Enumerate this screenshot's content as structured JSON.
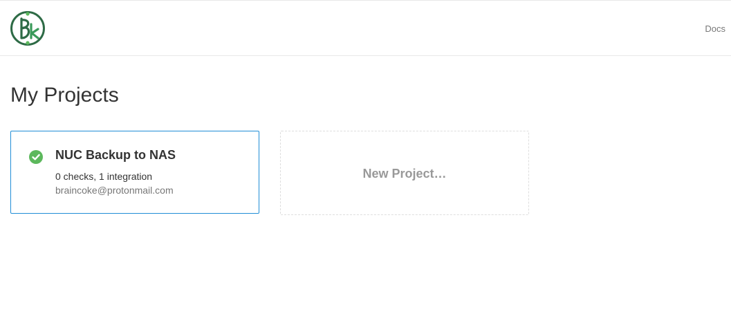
{
  "header": {
    "logo_name": "app-logo",
    "docs_label": "Docs"
  },
  "page": {
    "title": "My Projects"
  },
  "projects": [
    {
      "name": "NUC Backup to NAS",
      "summary": "0 checks, 1 integration",
      "owner": "braincoke@protonmail.com",
      "status_icon": "check-circle-icon",
      "status_color": "#5cb85c"
    }
  ],
  "new_project": {
    "label": "New Project…"
  },
  "colors": {
    "accent": "#1f8dd6",
    "success": "#5cb85c",
    "logo_green": "#2e6b46"
  }
}
